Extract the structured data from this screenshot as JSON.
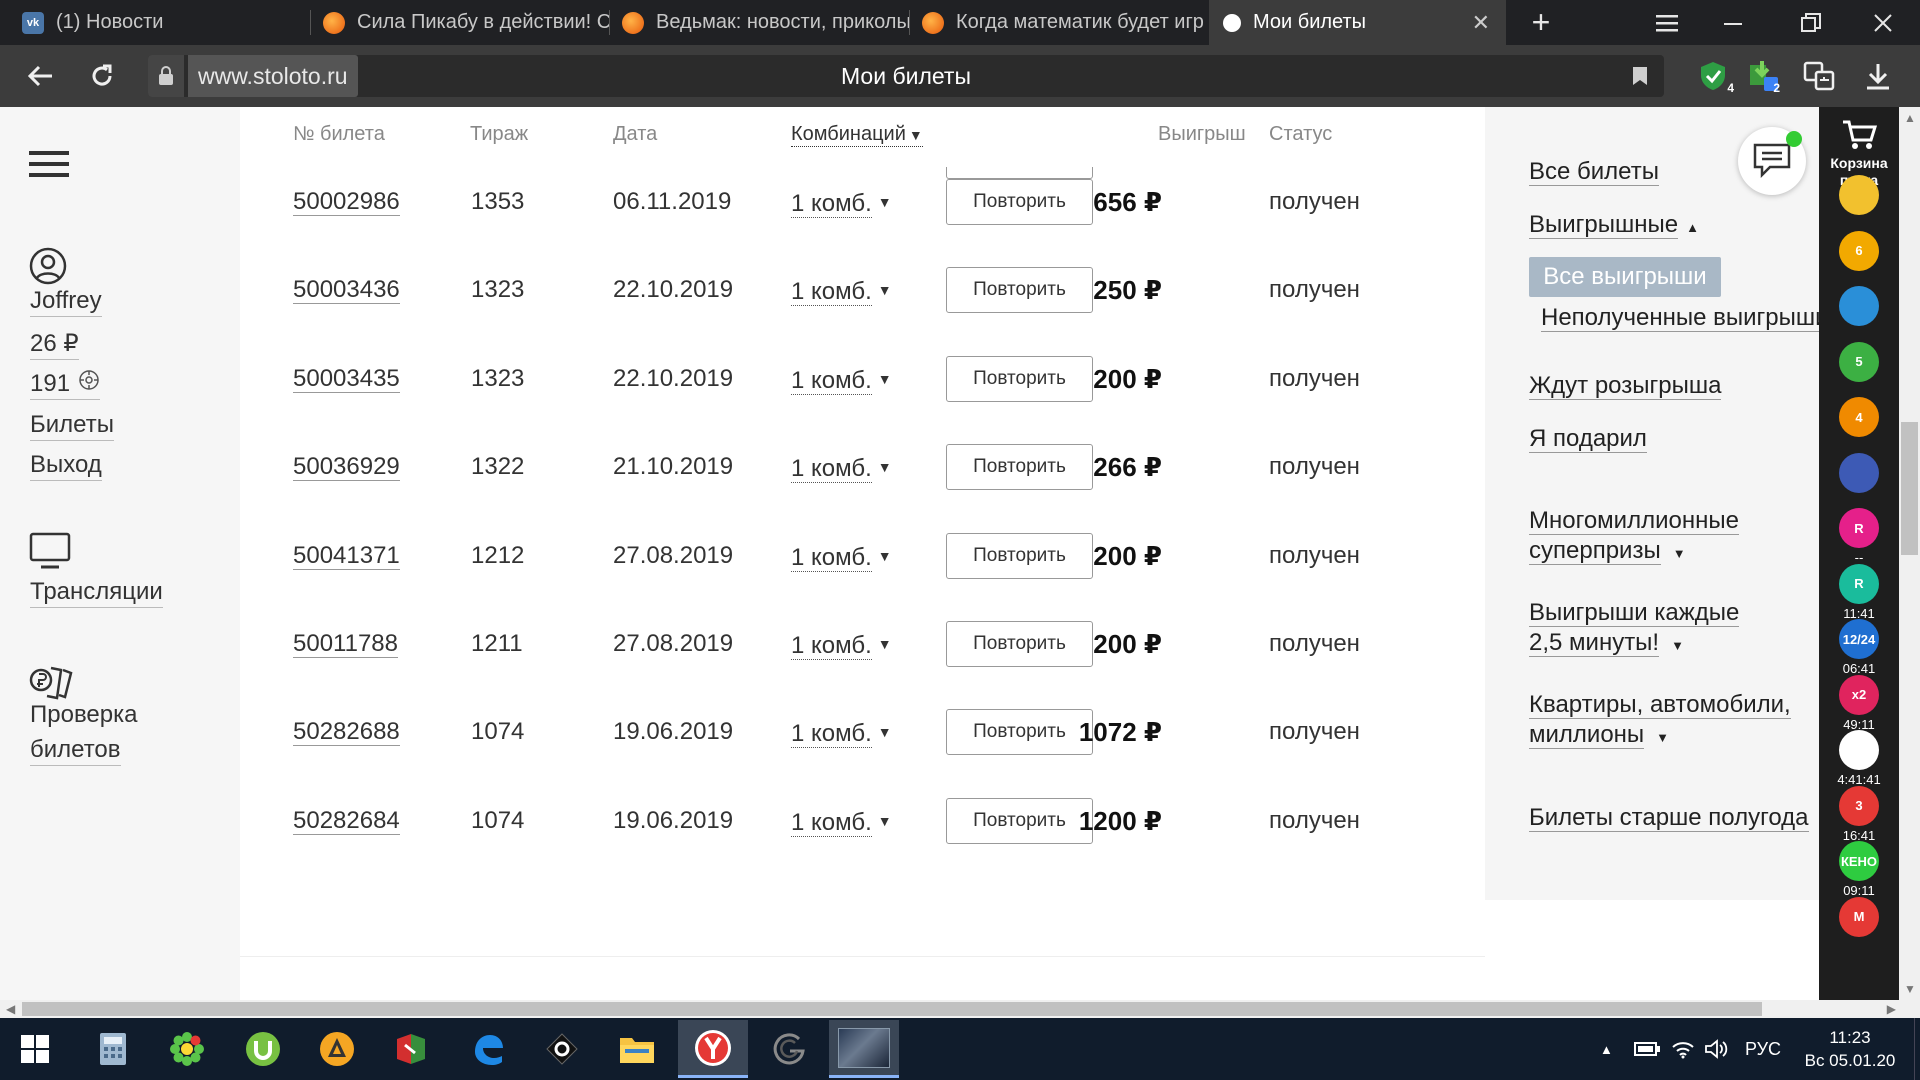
{
  "browser": {
    "tabs": [
      {
        "title": "(1) Новости",
        "icon": "vk-icon",
        "color": "#4a76a8"
      },
      {
        "title": "Сила Пикабу в действии! С",
        "icon": "pikabu-icon",
        "color": "#f39c12"
      },
      {
        "title": "Ведьмак: новости, приколы",
        "icon": "pikabu-icon",
        "color": "#f39c12"
      },
      {
        "title": "Когда математик будет игр",
        "icon": "pikabu-icon",
        "color": "#f39c12"
      },
      {
        "title": "Мои билеты",
        "icon": "stoloto-icon",
        "color": "#ffffff",
        "active": true
      }
    ],
    "url": "www.stoloto.ru",
    "page_title": "Мои билеты",
    "extension_badges": [
      "4",
      "2"
    ]
  },
  "sidebar": {
    "username": "Joffrey",
    "balance": "26 ₽",
    "bonus": "191",
    "links": {
      "tickets": "Билеты",
      "logout": "Выход",
      "broadcasts": "Трансляции",
      "check_line1": "Проверка",
      "check_line2": "билетов"
    }
  },
  "table": {
    "headers": {
      "ticket": "№ билета",
      "draw": "Тираж",
      "date": "Дата",
      "combinations": "Комбинаций",
      "win": "Выигрыш",
      "status": "Статус"
    },
    "repeat_label": "Повторить",
    "rows": [
      {
        "ticket": "50002986",
        "draw": "1353",
        "date": "06.11.2019",
        "comb": "1 комб.",
        "win": "656 ₽",
        "status": "получен"
      },
      {
        "ticket": "50003436",
        "draw": "1323",
        "date": "22.10.2019",
        "comb": "1 комб.",
        "win": "250 ₽",
        "status": "получен"
      },
      {
        "ticket": "50003435",
        "draw": "1323",
        "date": "22.10.2019",
        "comb": "1 комб.",
        "win": "200 ₽",
        "status": "получен"
      },
      {
        "ticket": "50036929",
        "draw": "1322",
        "date": "21.10.2019",
        "comb": "1 комб.",
        "win": "266 ₽",
        "status": "получен"
      },
      {
        "ticket": "50041371",
        "draw": "1212",
        "date": "27.08.2019",
        "comb": "1 комб.",
        "win": "200 ₽",
        "status": "получен"
      },
      {
        "ticket": "50011788",
        "draw": "1211",
        "date": "27.08.2019",
        "comb": "1 комб.",
        "win": "200 ₽",
        "status": "получен"
      },
      {
        "ticket": "50282688",
        "draw": "1074",
        "date": "19.06.2019",
        "comb": "1 комб.",
        "win": "1072 ₽",
        "status": "получен"
      },
      {
        "ticket": "50282684",
        "draw": "1074",
        "date": "19.06.2019",
        "comb": "1 комб.",
        "win": "1200 ₽",
        "status": "получен"
      }
    ]
  },
  "filters": {
    "all_tickets": "Все билеты",
    "winning": "Выигрышные",
    "all_wins": "Все выигрыши",
    "unreceived": "Неполученные выигрыши",
    "waiting": "Ждут розыгрыша",
    "gifted": "Я подарил",
    "multimillion_1": "Многомиллионные",
    "multimillion_2": "суперпризы",
    "every25_1": "Выигрыши каждые",
    "every25_2": "2,5 минуты!",
    "apartments_1": "Квартиры, автомобили,",
    "apartments_2": "миллионы",
    "older": "Билеты старше полугода"
  },
  "games": {
    "cart_label_1": "Корзина",
    "cart_label_2": "пуста",
    "items": [
      {
        "icon": "",
        "timer": "",
        "color": "#f2c12e"
      },
      {
        "icon": "6",
        "timer": "",
        "color": "#f2a900"
      },
      {
        "icon": "",
        "timer": "",
        "color": "#2a8fd8"
      },
      {
        "icon": "5",
        "timer": "",
        "color": "#3cb043"
      },
      {
        "icon": "4",
        "timer": "",
        "color": "#f08a00"
      },
      {
        "icon": "",
        "timer": "",
        "color": "#3d5ab5"
      },
      {
        "icon": "R",
        "timer": "--",
        "color": "#e5208a"
      },
      {
        "icon": "R",
        "timer": "11:41",
        "color": "#1abc9c"
      },
      {
        "icon": "12/24",
        "timer": "06:41",
        "color": "#1f6fd1"
      },
      {
        "icon": "x2",
        "timer": "49:11",
        "color": "#e0245e"
      },
      {
        "icon": "",
        "timer": "4:41:41",
        "color": "#ffffff"
      },
      {
        "icon": "3",
        "timer": "16:41",
        "color": "#e53935"
      },
      {
        "icon": "КЕНО",
        "timer": "09:11",
        "color": "#2ecc40"
      },
      {
        "icon": "M",
        "timer": "",
        "color": "#e53935"
      }
    ]
  },
  "taskbar": {
    "language": "РУС",
    "time": "11:23",
    "date": "Вс 05.01.20"
  }
}
